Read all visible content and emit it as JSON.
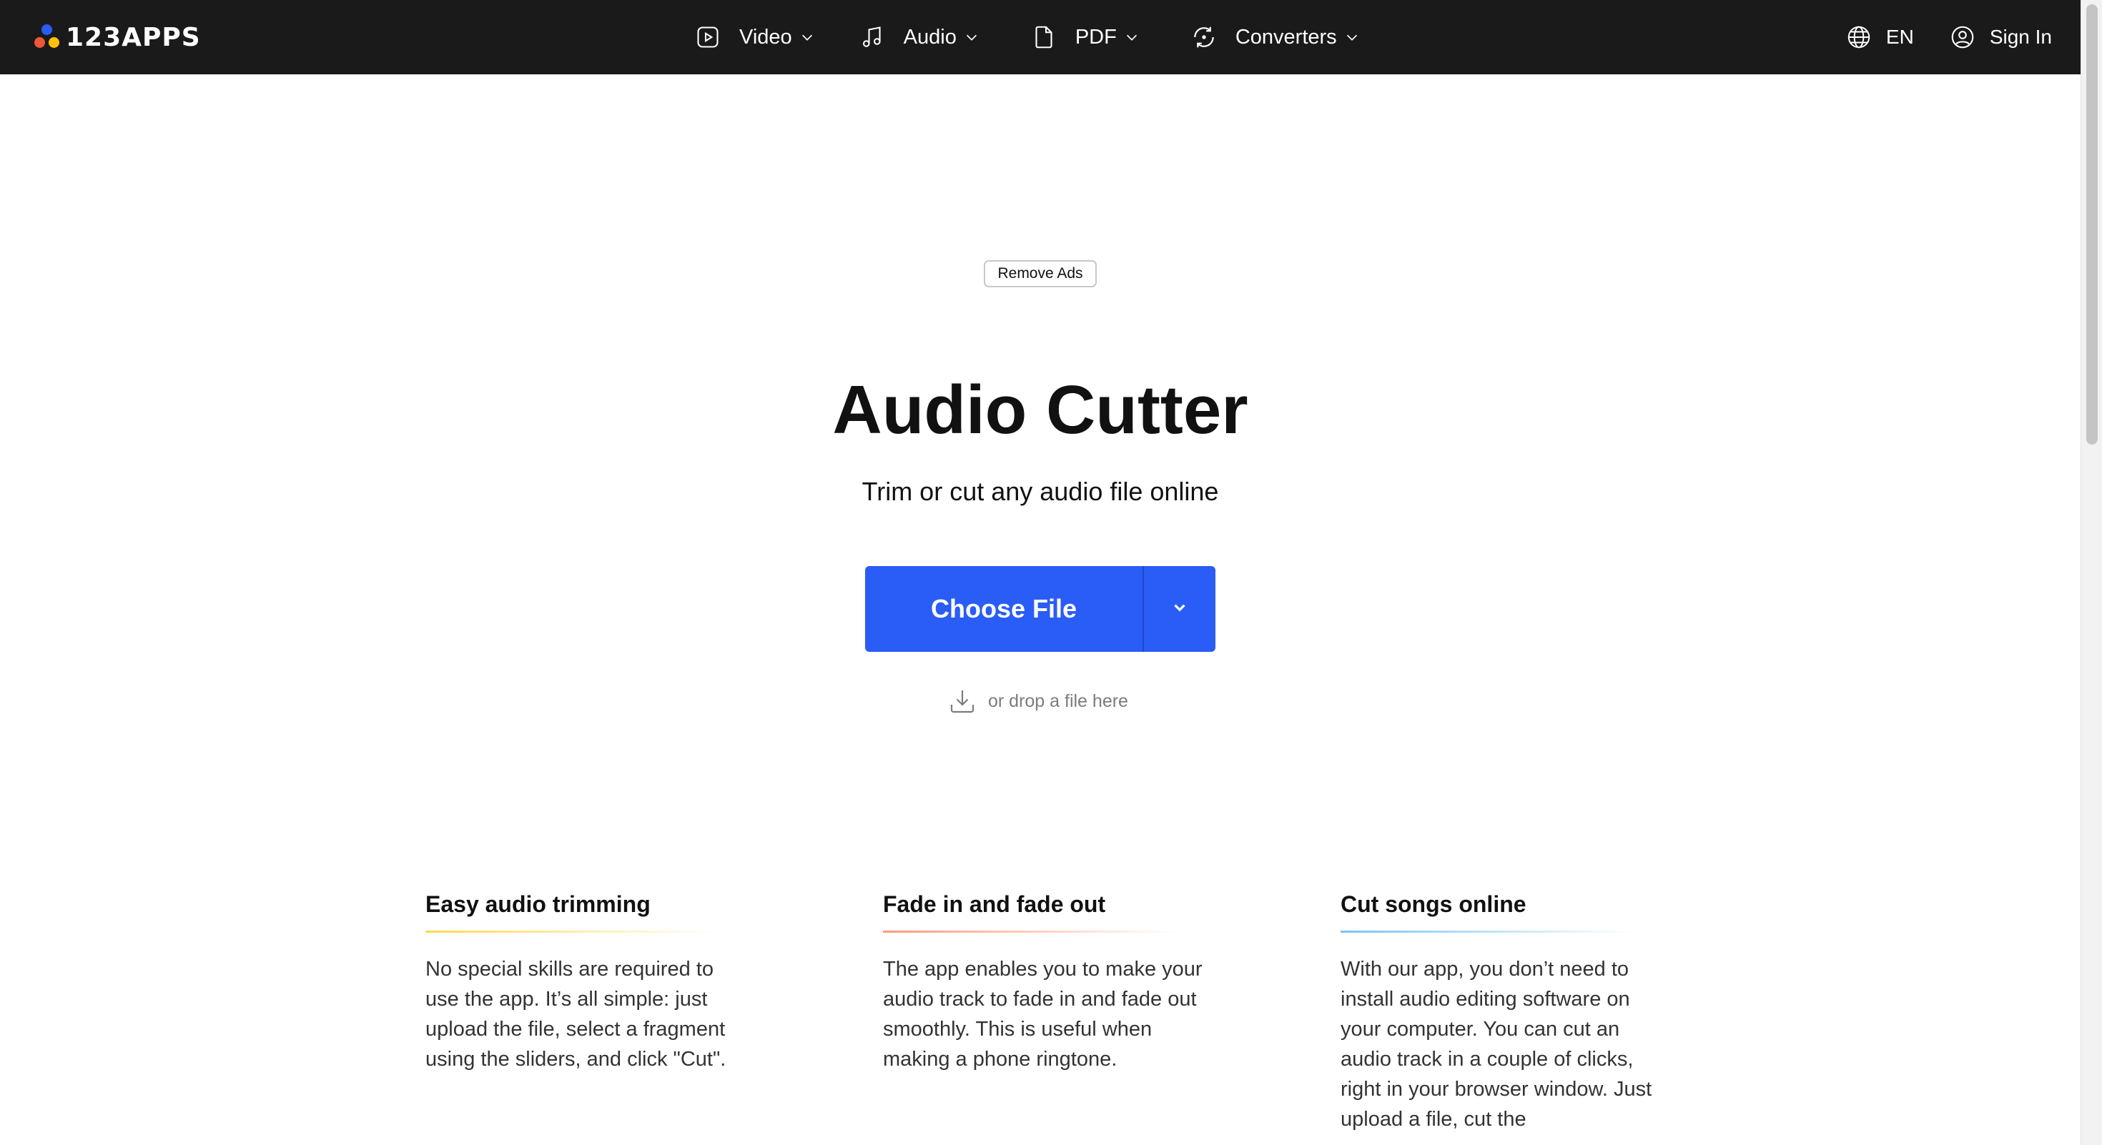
{
  "header": {
    "logo_text": "123APPS",
    "logo_colors": [
      "#2a5cf6",
      "#f0563a",
      "#ffc107"
    ],
    "nav": [
      {
        "label": "Video",
        "icon": "video-play-icon"
      },
      {
        "label": "Audio",
        "icon": "music-note-icon"
      },
      {
        "label": "PDF",
        "icon": "document-icon"
      },
      {
        "label": "Converters",
        "icon": "convert-arrows-icon"
      }
    ],
    "language": "EN",
    "sign_in": "Sign In"
  },
  "ads": {
    "remove_ads_label": "Remove Ads"
  },
  "hero": {
    "title": "Audio Cutter",
    "subtitle": "Trim or cut any audio file online",
    "choose_file_label": "Choose File",
    "drop_hint": "or drop a file here",
    "accent_color": "#2a5cf6"
  },
  "features": [
    {
      "title": "Easy audio trimming",
      "text": "No special skills are required to use the app. It’s all simple: just upload the file, select a fragment using the sliders, and click \"Cut\".",
      "underline_color": "#ffd84d"
    },
    {
      "title": "Fade in and fade out",
      "text": "The app enables you to make your audio track to fade in and fade out smoothly. This is useful when making a phone ringtone.",
      "underline_color": "#ff9a7a"
    },
    {
      "title": "Cut songs online",
      "text": "With our app, you don’t need to install audio editing software on your computer. You can cut an audio track in a couple of clicks, right in your browser window. Just upload a file, cut the",
      "underline_color": "#7ac3f0"
    }
  ]
}
